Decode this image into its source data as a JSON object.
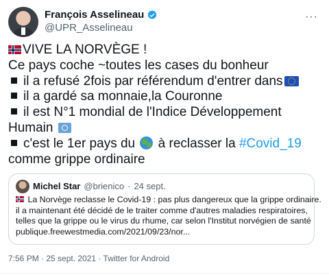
{
  "author": {
    "display_name": "François Asselineau",
    "handle": "@UPR_Asselineau"
  },
  "more_label": "···",
  "tweet": {
    "line1": "VIVE LA NORVÈGE !",
    "line2": "Ce pays coche ~toutes les cases du bonheur",
    "line3": "il a refusé 2fois par référendum d'entrer dans",
    "line4": "il a gardé sa monnaie,la Couronne",
    "line5": "il est N°1 mondial de l'Indice Développement",
    "line6": "Humain",
    "line7a": "c'est le 1er pays du",
    "line7b": "à reclasser la",
    "hashtag": "#Covid_19",
    "line8": "comme grippe ordinaire"
  },
  "quote": {
    "name": "Michel Star",
    "handle": "@brienico",
    "sep": "·",
    "date": "24 sept.",
    "line1": "La Norvège reclasse le Covid-19 : pas plus dangereux que la grippe ordinaire.",
    "line2": "il a maintenant été décidé de le traiter comme d'autres maladies respiratoires,",
    "line3": "telles que la grippe ou le virus du rhume, car selon l'Institut norvégien de santé",
    "line4": "publique.freewestmedia.com/2021/09/23/nor..."
  },
  "meta": "7:56 PM · 25 sept. 2021 · Twitter for Android",
  "colors": {
    "link": "#1d9bf0",
    "secondary_text": "#536471",
    "border": "#cfd9de"
  }
}
